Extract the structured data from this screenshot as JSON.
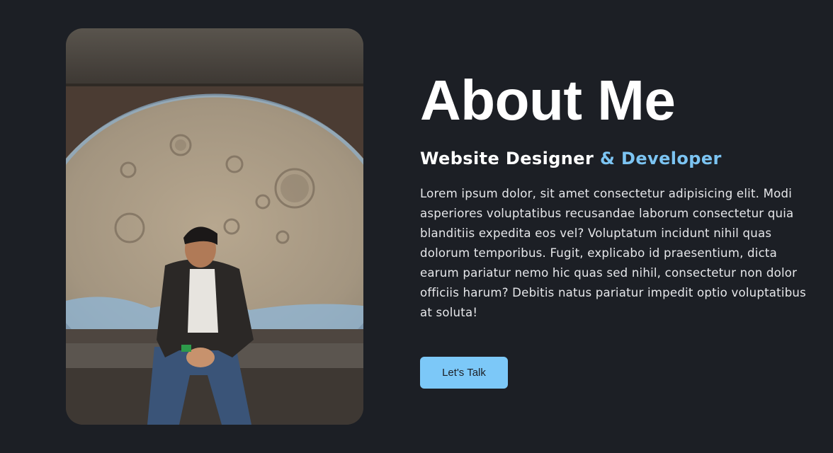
{
  "about": {
    "heading": "About Me",
    "role_primary": "Website Designer",
    "role_accent": "& Developer",
    "description": "Lorem ipsum dolor, sit amet consectetur adipisicing elit. Modi asperiores voluptatibus recusandae laborum consectetur quia blanditiis expedita eos vel? Voluptatum incidunt nihil quas dolorum temporibus. Fugit, explicabo id praesentium, dicta earum pariatur nemo hic quas sed nihil, consectetur non dolor officiis harum? Debitis natus pariatur impedit optio voluptatibus at soluta!",
    "cta_label": "Let's Talk"
  },
  "colors": {
    "background": "#1c1f25",
    "accent": "#7cc4f2",
    "button": "#7cc8f8",
    "text": "#ffffff"
  }
}
